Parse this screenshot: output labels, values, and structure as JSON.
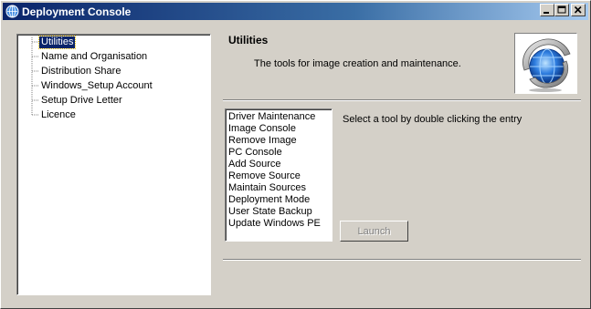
{
  "window": {
    "title": "Deployment Console"
  },
  "tree": {
    "items": [
      {
        "label": "Utilities",
        "selected": true
      },
      {
        "label": "Name and Organisation"
      },
      {
        "label": "Distribution Share"
      },
      {
        "label": "Windows_Setup Account"
      },
      {
        "label": "Setup Drive Letter"
      },
      {
        "label": "Licence"
      }
    ]
  },
  "header": {
    "title": "Utilities",
    "description": "The tools for image creation and maintenance.",
    "image_icon": "deployment-globe-icon"
  },
  "tools": {
    "items": [
      "Driver Maintenance",
      "Image Console",
      "Remove Image",
      "PC Console",
      "Add Source",
      "Remove Source",
      "Maintain Sources",
      "Deployment Mode",
      "User State Backup",
      "Update Windows PE"
    ],
    "hint": "Select a tool by double clicking the entry",
    "launch_label": "Launch"
  },
  "colors": {
    "titlebar_start": "#0a246a",
    "titlebar_end": "#a6caf0",
    "selection": "#0a246a",
    "face": "#d4d0c8"
  }
}
